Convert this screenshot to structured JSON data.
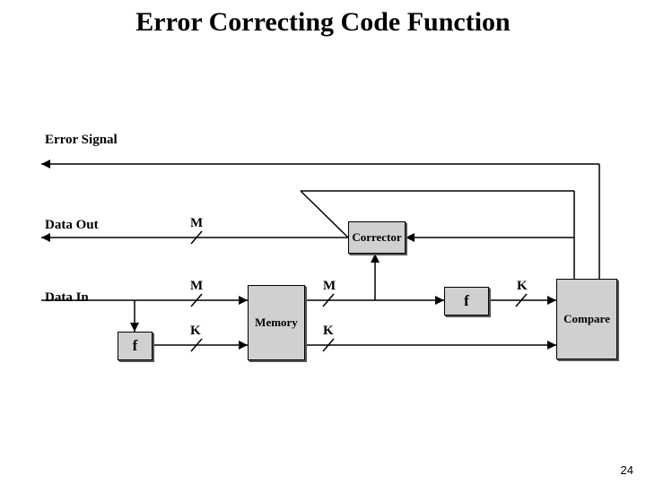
{
  "title": "Error Correcting Code Function",
  "labels": {
    "error_signal": "Error Signal",
    "data_out": "Data Out",
    "data_in": "Data In"
  },
  "bus": {
    "M": "M",
    "K": "K"
  },
  "blocks": {
    "f": "f",
    "memory": "Memory",
    "corrector": "Corrector",
    "compare": "Compare"
  },
  "page": "24"
}
